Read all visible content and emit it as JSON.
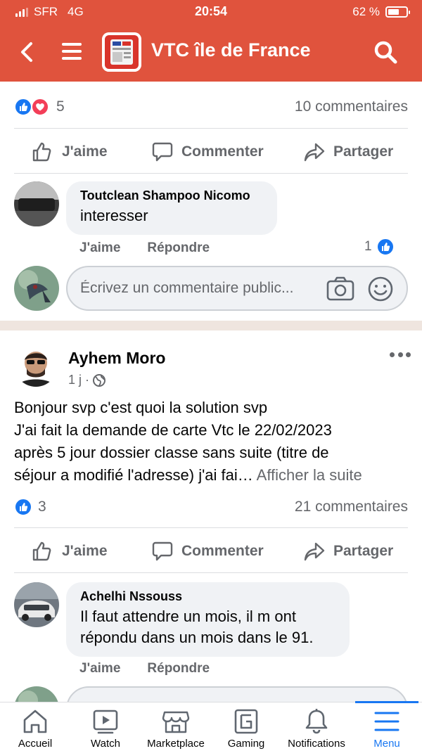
{
  "status_bar": {
    "carrier": "SFR",
    "network": "4G",
    "time": "20:54",
    "battery": "62 %",
    "battery_level": 0.62
  },
  "header": {
    "title": "VTC île de France",
    "color": "#e0533d"
  },
  "post1": {
    "reaction_count": "5",
    "comments_count": "10 commentaires",
    "actions": {
      "like": "J'aime",
      "comment": "Commenter",
      "share": "Partager"
    },
    "comment": {
      "author": "Toutclean Shampoo Nicomo",
      "text": "interesser",
      "like_label": "J'aime",
      "reply_label": "Répondre",
      "likes": "1"
    },
    "composer": {
      "placeholder": "Écrivez un commentaire public..."
    }
  },
  "post2": {
    "author": "Ayhem Moro",
    "time": "1 j ·",
    "body_lines": [
      "Bonjour svp c'est quoi la solution svp",
      "J'ai fait la demande de carte Vtc le 22/02/2023",
      "après 5 jour dossier classe sans suite (titre de",
      "séjour a modifié l'adresse) j'ai fai…"
    ],
    "see_more": "Afficher la suite",
    "reaction_count": "3",
    "comments_count": "21 commentaires",
    "actions": {
      "like": "J'aime",
      "comment": "Commenter",
      "share": "Partager"
    },
    "comment": {
      "author": "Achelhi Nssouss",
      "text_line1": "Il faut attendre un mois, il m ont",
      "text_line2": "répondu dans un mois dans le 91.",
      "like_label": "J'aime",
      "reply_label": "Répondre"
    }
  },
  "tabbar": {
    "items": [
      {
        "label": "Accueil",
        "icon": "home-icon"
      },
      {
        "label": "Watch",
        "icon": "watch-icon"
      },
      {
        "label": "Marketplace",
        "icon": "marketplace-icon"
      },
      {
        "label": "Gaming",
        "icon": "gaming-icon"
      },
      {
        "label": "Notifications",
        "icon": "bell-icon"
      },
      {
        "label": "Menu",
        "icon": "menu-icon"
      }
    ],
    "active": "Menu",
    "accent": "#1877f2"
  }
}
